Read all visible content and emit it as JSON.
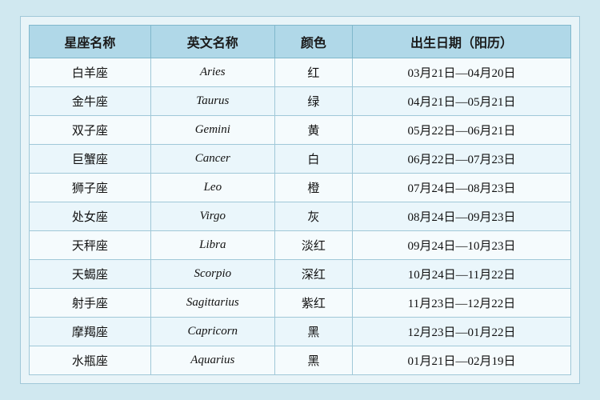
{
  "table": {
    "headers": [
      "星座名称",
      "英文名称",
      "颜色",
      "出生日期（阳历）"
    ],
    "rows": [
      [
        "白羊座",
        "Aries",
        "红",
        "03月21日—04月20日"
      ],
      [
        "金牛座",
        "Taurus",
        "绿",
        "04月21日—05月21日"
      ],
      [
        "双子座",
        "Gemini",
        "黄",
        "05月22日—06月21日"
      ],
      [
        "巨蟹座",
        "Cancer",
        "白",
        "06月22日—07月23日"
      ],
      [
        "狮子座",
        "Leo",
        "橙",
        "07月24日—08月23日"
      ],
      [
        "处女座",
        "Virgo",
        "灰",
        "08月24日—09月23日"
      ],
      [
        "天秤座",
        "Libra",
        "淡红",
        "09月24日—10月23日"
      ],
      [
        "天蝎座",
        "Scorpio",
        "深红",
        "10月24日—11月22日"
      ],
      [
        "射手座",
        "Sagittarius",
        "紫红",
        "11月23日—12月22日"
      ],
      [
        "摩羯座",
        "Capricorn",
        "黑",
        "12月23日—01月22日"
      ],
      [
        "水瓶座",
        "Aquarius",
        "黑",
        "01月21日—02月19日"
      ]
    ]
  }
}
